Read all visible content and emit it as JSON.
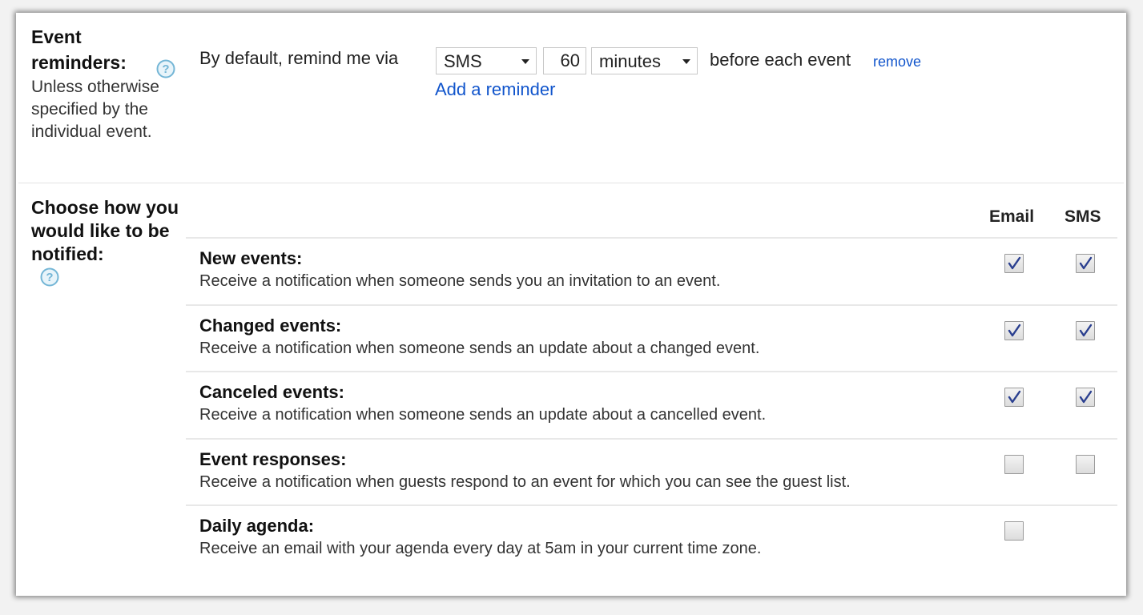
{
  "event_reminders": {
    "title": "Event reminders:",
    "description": "Unless otherwise specified by the individual event.",
    "lead_text": "By default, remind me via",
    "method": "SMS",
    "amount": "60",
    "unit": "minutes",
    "trailing_text": "before each event",
    "remove_label": "remove",
    "add_label": "Add a reminder"
  },
  "notifications": {
    "title": "Choose how you would like to be notified:",
    "columns": [
      "Email",
      "SMS"
    ],
    "rows": [
      {
        "title": "New events:",
        "desc": "Receive a notification when someone sends you an invitation to an event.",
        "email": true,
        "sms": true
      },
      {
        "title": "Changed events:",
        "desc": "Receive a notification when someone sends an update about a changed event.",
        "email": true,
        "sms": true
      },
      {
        "title": "Canceled events:",
        "desc": "Receive a notification when someone sends an update about a cancelled event.",
        "email": true,
        "sms": true
      },
      {
        "title": "Event responses:",
        "desc": "Receive a notification when guests respond to an event for which you can see the guest list.",
        "email": false,
        "sms": false
      },
      {
        "title": "Daily agenda:",
        "desc": "Receive an email with your agenda every day at 5am in your current time zone.",
        "email": false,
        "sms": null
      }
    ]
  },
  "colors": {
    "link": "#1155cc",
    "help_icon": "#74b6d6",
    "check": "#2a3f8f"
  }
}
